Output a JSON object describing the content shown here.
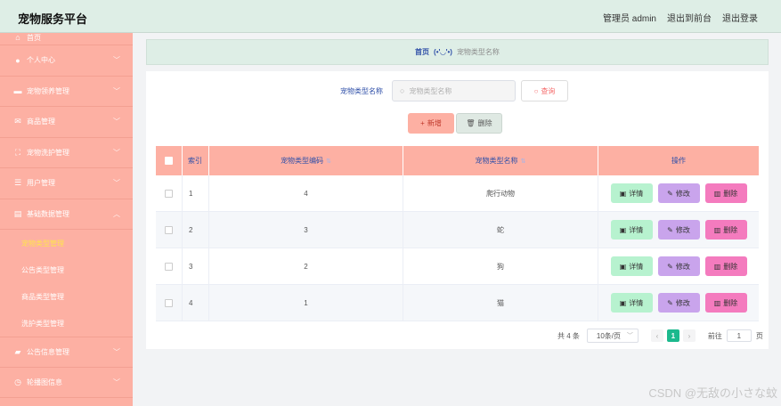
{
  "app": {
    "title": "宠物服务平台"
  },
  "header": {
    "admin": "管理员 admin",
    "front": "退出到前台",
    "logout": "退出登录"
  },
  "sidebar": {
    "items": [
      {
        "label": "首页",
        "icon": "home-icon"
      },
      {
        "label": "个人中心",
        "icon": "user-icon"
      },
      {
        "label": "宠物领养管理",
        "icon": "briefcase-icon"
      },
      {
        "label": "商品管理",
        "icon": "mail-icon"
      },
      {
        "label": "宠物洗护管理",
        "icon": "scan-icon"
      },
      {
        "label": "用户管理",
        "icon": "sliders-icon"
      },
      {
        "label": "基础数据管理",
        "icon": "clipboard-icon"
      },
      {
        "label": "公告信息管理",
        "icon": "ticket-icon"
      },
      {
        "label": "轮播图信息",
        "icon": "clock-icon"
      }
    ],
    "sub_items": [
      "宠物类型管理",
      "公告类型管理",
      "商品类型管理",
      "洗护类型管理"
    ]
  },
  "breadcrumb": {
    "home": "首页",
    "face": "(•'◡'•)",
    "current": "宠物类型名称"
  },
  "search": {
    "label": "宠物类型名称",
    "placeholder": "宠物类型名称",
    "query_label": "查询"
  },
  "actions": {
    "add_label": "新增",
    "delete_label": "删除"
  },
  "table": {
    "headers": {
      "index": "索引",
      "code": "宠物类型编码",
      "name": "宠物类型名称",
      "op": "操作"
    },
    "rows": [
      {
        "index": "1",
        "code": "4",
        "name": "爬行动物"
      },
      {
        "index": "2",
        "code": "3",
        "name": "蛇"
      },
      {
        "index": "3",
        "code": "2",
        "name": "狗"
      },
      {
        "index": "4",
        "code": "1",
        "name": "猫"
      }
    ],
    "op_labels": {
      "detail": "详情",
      "edit": "修改",
      "remove": "删除"
    }
  },
  "pagination": {
    "total": "共 4 条",
    "page_size": "10条/页",
    "current_page": "1",
    "goto_label": "前往",
    "goto_value": "1",
    "page_suffix": "页"
  },
  "watermark": "CSDN @无敌の小さな蚊",
  "colors": {
    "sidebar": "#fdb0a3",
    "header": "#deeee6",
    "accent": "#1cb98d"
  }
}
